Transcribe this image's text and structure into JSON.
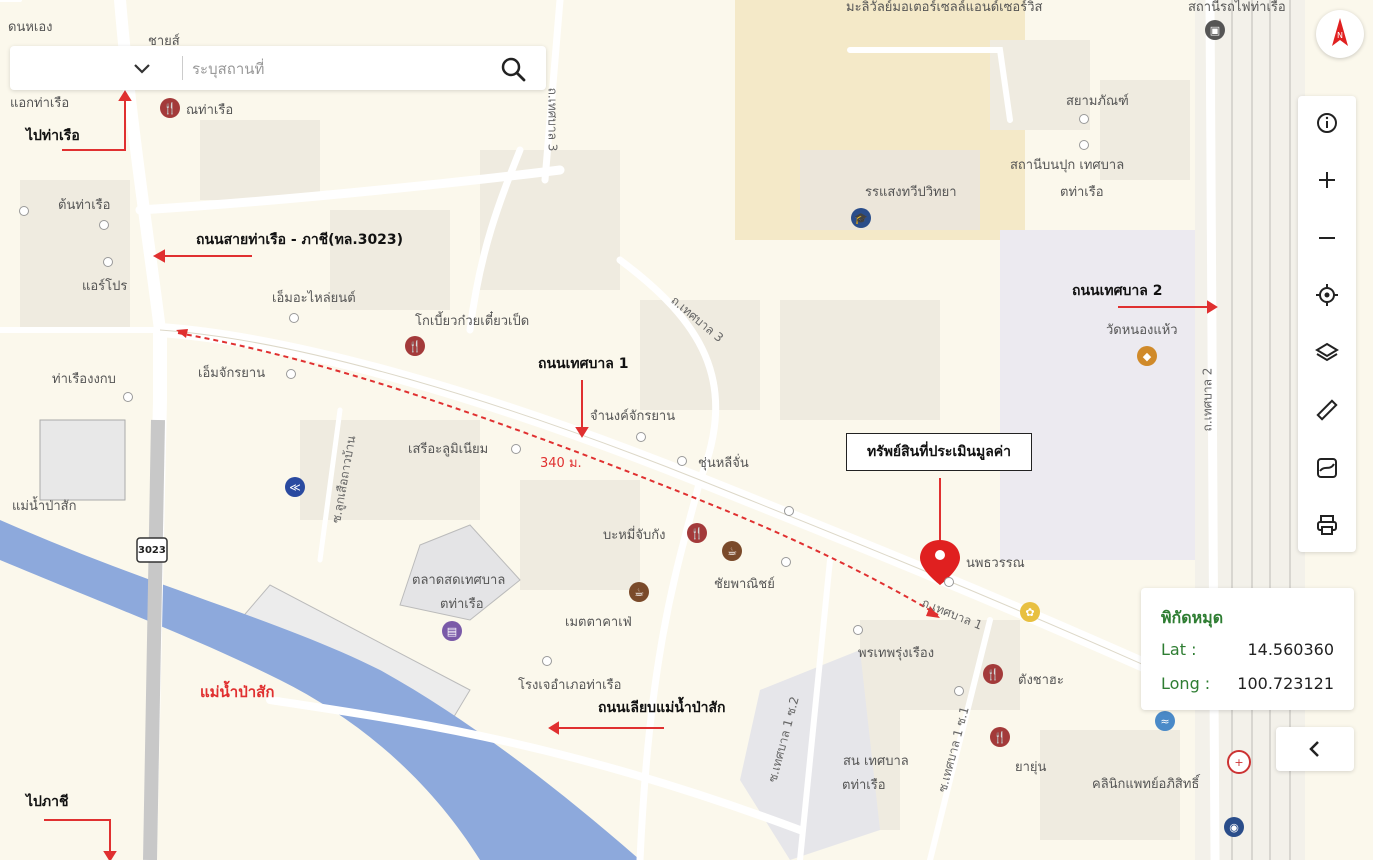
{
  "search": {
    "placeholder": "ระบุสถานที่"
  },
  "annotations": {
    "to_port": "ไปท่าเรือ",
    "to_phachi": "ไปภาชี",
    "road_3023": "ถนนสายท่าเรือ - ภาชี(ทล.3023)",
    "road_thetsaban1": "ถนนเทศบาล 1",
    "road_thetsaban2": "ถนนเทศบาล 2",
    "road_riverside": "ถนนเลียบแม่น้ำป่าสัก",
    "distance": "340 ม.",
    "property": "ทรัพย์สินที่ประเมินมูลค่า",
    "river": "แม่น้ำป่าสัก"
  },
  "map_labels": {
    "l1": "ดนหเอง",
    "l2": "ชายส์",
    "l3": "แอกท่าเรือ",
    "l4": "ณท่าเรือ",
    "l5": "ต้นท่าเรือ",
    "l6": "แอร์โปร",
    "l7": "เอ็มอะไหล่ยนต์",
    "l8": "โกเบี้ยวก๋วยเตี๋ยวเป็ด",
    "l9": "เอ็มจักรยาน",
    "l10": "ท่าเรืองงกบ",
    "l11": "จำนงค์จักรยาน",
    "l12": "เสรีอะลูมิเนียม",
    "l13": "ชุ่นหลีจั่น",
    "l14": "บะหมี่จับกัง",
    "l15": "ชัยพาณิชย์",
    "l16": "ตลาดสดเทศบาล",
    "l17": "ตท่าเรือ",
    "l18": "เมตตาคาเฟ่",
    "l19": "โรงเจอำเภอท่าเรือ",
    "l20": "นพธวรรณ",
    "l21": "พรเทพรุ่งเรือง",
    "l22": "ตังชาฮะ",
    "l23": "ยายุ่น",
    "l24": "สน เทศบาล",
    "l25": "ตท่าเรือ",
    "l26": "คลินิกแพทย์อภิสิทธิ์",
    "l27": "รรแสงทวีปวิทยา",
    "l28": "สถานีบนปุก เทศบาล",
    "l29": "ตท่าเรือ",
    "l30": "สยามภัณฑ์",
    "l31": "วัดหนองแห้ว",
    "l32": "มะลิวัลย์มอเตอร์เซลล์แอนด์เซอร์วิส",
    "l33": "สถานีรถไฟท่าเรือ",
    "l34": "แม่น้ำป่าสัก",
    "road_r1": "ถ.เทศบาล 3",
    "road_r2": "ถ.เทศบาล 3",
    "road_r3": "ถ.เทศบาล 1",
    "road_r4": "ถ.เทศบาล 2",
    "road_r5": "ซ.ลูกเสือถาวบ้าน",
    "road_r6": "ซ.เทศบาล 1 ซ.2",
    "road_r7": "ซ.เทศบาล 1 ซ.1",
    "shield": "3023"
  },
  "coords": {
    "title": "พิกัดหมุด",
    "lat_label": "Lat :",
    "lat_value": "14.560360",
    "long_label": "Long :",
    "long_value": "100.723121"
  },
  "colors": {
    "water": "#8da9dc",
    "road_main": "#ffffff",
    "annotation_arrow": "#e03030",
    "accent_green": "#2e7d32",
    "marker": "#e02020"
  },
  "icons": [
    "chevron-down-icon",
    "search-icon",
    "compass-icon",
    "info-icon",
    "zoom-in-icon",
    "zoom-out-icon",
    "locate-icon",
    "layers-icon",
    "ruler-icon",
    "map-style-icon",
    "print-icon",
    "chevron-left-icon",
    "location-pin-icon"
  ]
}
